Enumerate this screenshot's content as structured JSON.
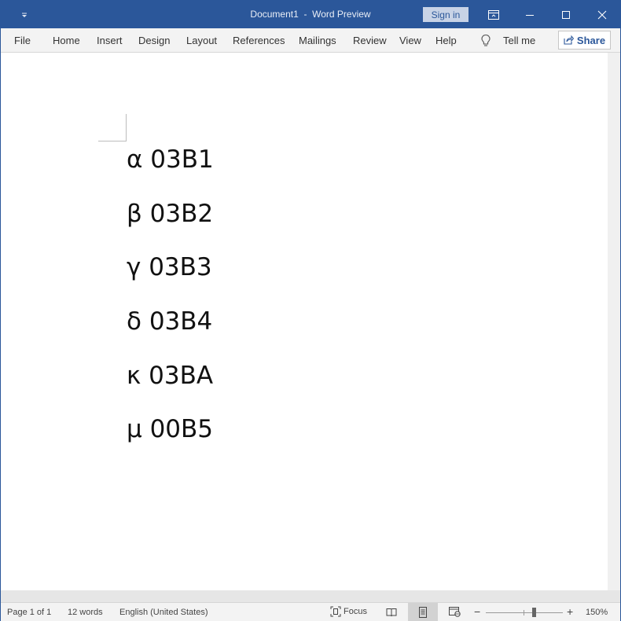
{
  "window": {
    "doc_name": "Document1",
    "separator": "  -  ",
    "app_name": "Word Preview",
    "sign_in": "Sign in"
  },
  "ribbon": {
    "tabs": [
      "File",
      "Home",
      "Insert",
      "Design",
      "Layout",
      "References",
      "Mailings",
      "Review",
      "View",
      "Help"
    ],
    "tell_me": "Tell me",
    "share": "Share"
  },
  "document": {
    "lines": [
      "α 03B1",
      "β 03B2",
      "γ 03B3",
      "δ 03B4",
      "κ 03BA",
      "μ 00B5"
    ]
  },
  "status": {
    "page": "Page 1 of 1",
    "words": "12 words",
    "language": "English (United States)",
    "focus": "Focus",
    "zoom": "150%",
    "zoom_level": 1.5
  },
  "colors": {
    "titlebar": "#2b579a",
    "accent": "#2b579a"
  },
  "icons": {
    "qat": "customize-quick-access-icon",
    "ribbon_display": "ribbon-display-options-icon",
    "minimize": "minimize-icon",
    "maximize": "maximize-icon",
    "close": "close-icon",
    "tell_me": "lightbulb-icon",
    "share": "share-icon",
    "focus": "focus-icon",
    "read_mode": "read-mode-icon",
    "print_layout": "print-layout-icon",
    "web_layout": "web-layout-icon"
  }
}
